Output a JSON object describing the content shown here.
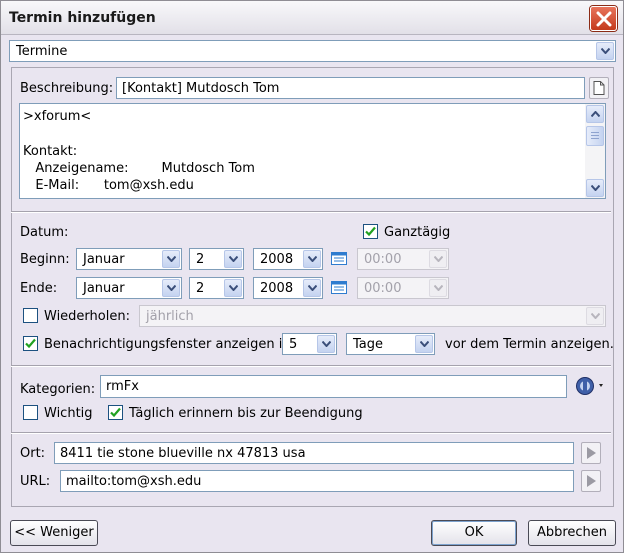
{
  "window": {
    "title": "Termin hinzufügen"
  },
  "calendar": {
    "selected": "Termine"
  },
  "description": {
    "label": "Beschreibung:",
    "value": "[Kontakt] Mutdosch Tom",
    "body": {
      "line1": ">xforum<",
      "line2": "Kontakt:",
      "line3": "   Anzeigename:        Mutdosch Tom",
      "line4": "   E-Mail:      tom@xsh.edu"
    }
  },
  "date": {
    "label": "Datum:",
    "allday_label": "Ganztägig",
    "allday_checked": true,
    "begin": {
      "label": "Beginn:",
      "month": "Januar",
      "day": "2",
      "year": "2008",
      "time": "00:00"
    },
    "end": {
      "label": "Ende:",
      "month": "Januar",
      "day": "2",
      "year": "2008",
      "time": "00:00"
    }
  },
  "repeat": {
    "label": "Wiederholen:",
    "checked": false,
    "value": "jährlich"
  },
  "notification": {
    "checked": true,
    "label": "Benachrichtigungsfenster anzeigen in",
    "amount": "5",
    "unit": "Tage",
    "suffix": "vor dem Termin anzeigen."
  },
  "categories": {
    "label": "Kategorien:",
    "value": "rmFx"
  },
  "important": {
    "label": "Wichtig",
    "checked": false
  },
  "daily_reminder": {
    "label": "Täglich erinnern bis zur Beendigung",
    "checked": true
  },
  "location": {
    "label": "Ort:",
    "value": "8411 tie stone blueville nx 47813 usa"
  },
  "url": {
    "label": "URL:",
    "value": "mailto:tom@xsh.edu"
  },
  "buttons": {
    "less": "<< Weniger",
    "ok": "OK",
    "cancel": "Abbrechen"
  },
  "colors": {
    "accent": "#2f7ccf",
    "check": "#21a121",
    "close": "#d4502f"
  },
  "icons": [
    "close-icon",
    "document-icon",
    "calendar-icon",
    "category-icon",
    "play-icon",
    "chevron-down-icon",
    "check-icon"
  ]
}
